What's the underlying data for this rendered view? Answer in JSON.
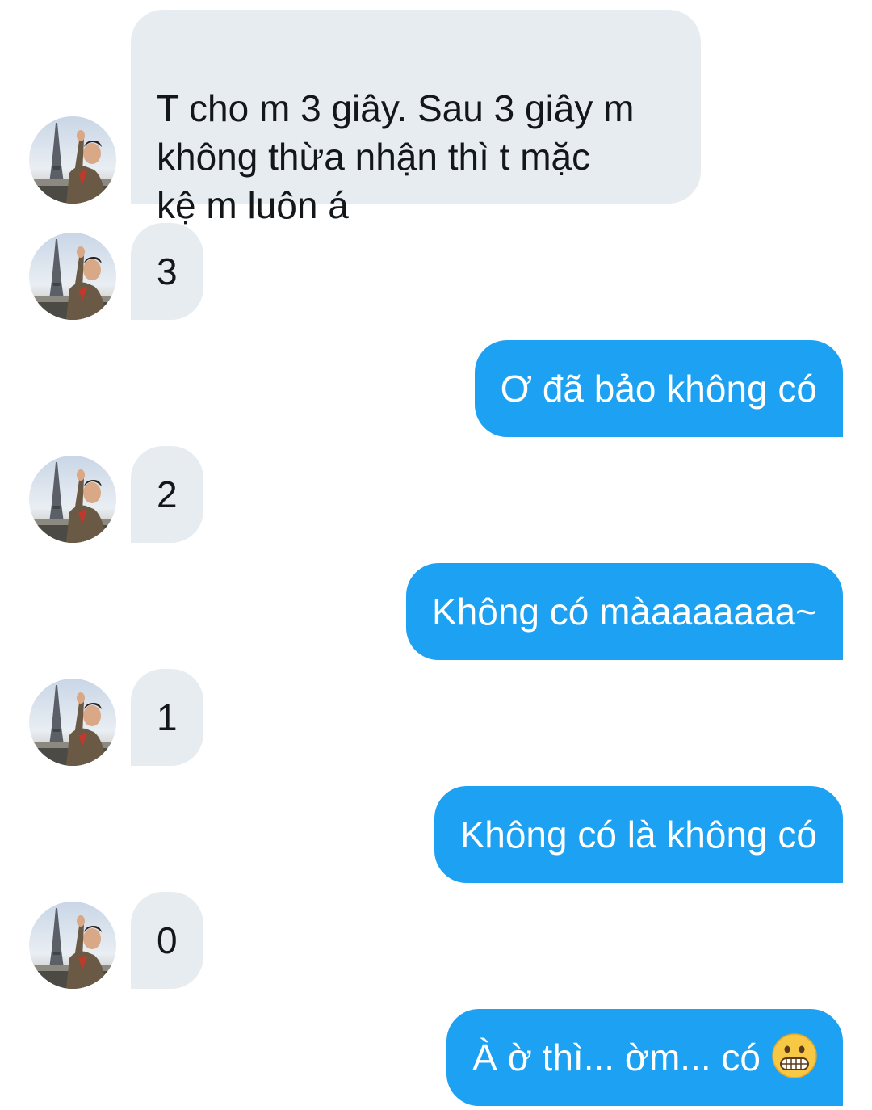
{
  "conversation": {
    "messages": [
      {
        "sender": "them",
        "text": "T cho m 3 giây. Sau 3 giây m\nkhông thừa nhận thì t mặc\nkệ m luôn á"
      },
      {
        "sender": "them",
        "text": "3"
      },
      {
        "sender": "me",
        "text": "Ơ đã bảo không có"
      },
      {
        "sender": "them",
        "text": "2"
      },
      {
        "sender": "me",
        "text": "Không có màaaaaaaa~"
      },
      {
        "sender": "them",
        "text": "1"
      },
      {
        "sender": "me",
        "text": "Không có là không có"
      },
      {
        "sender": "them",
        "text": "0"
      },
      {
        "sender": "me",
        "text": "À ờ thì... ờm... có",
        "emoji": "grimacing-face"
      }
    ]
  },
  "colors": {
    "incoming_bubble": "#e6ecf0",
    "outgoing_bubble": "#1da1f2",
    "incoming_text": "#14171a",
    "outgoing_text": "#ffffff"
  }
}
